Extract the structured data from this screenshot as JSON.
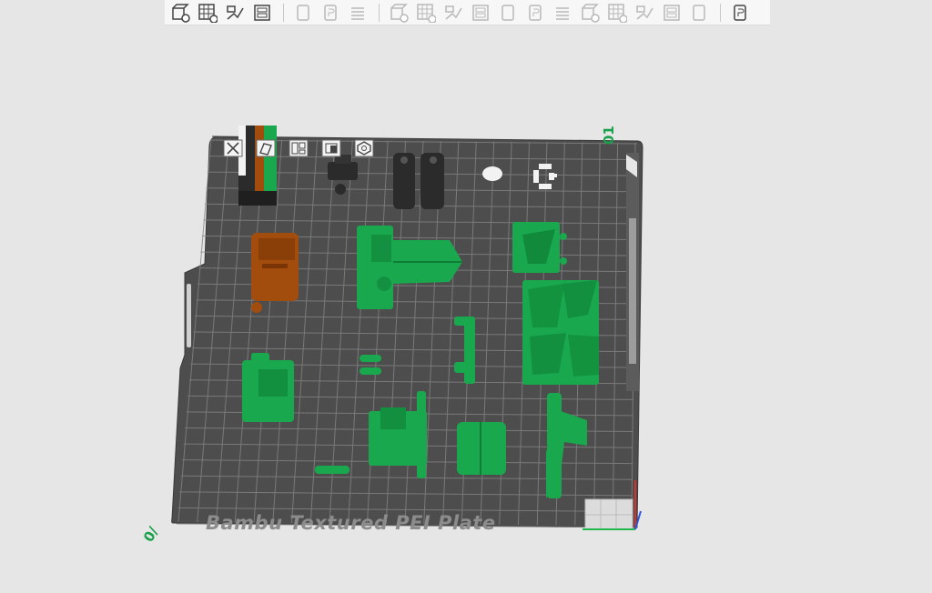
{
  "toolbar": {
    "groups": [
      [
        "add-cube-icon",
        "add-grid-icon",
        "auto-orient-icon",
        "arrange-icon"
      ],
      [
        "copy-plate-icon",
        "plate-p-icon",
        "layer-icon"
      ],
      [
        "move-icon",
        "rotate-icon",
        "scale-icon",
        "lay-flat-icon",
        "cut-icon",
        "split-icon",
        "boolean-icon",
        "support-icon",
        "text-icon",
        "paint-icon",
        "measure-icon",
        "assembly-icon"
      ],
      [
        "view-icon"
      ]
    ]
  },
  "plate": {
    "label": "Bambu Textured PEI Plate",
    "number": "01",
    "number_bottom": "0/",
    "tools": [
      "close-plate-icon",
      "orient-plate-icon",
      "arrange-plate-icon",
      "lock-plate-icon",
      "settings-plate-icon"
    ],
    "colors": {
      "plate": "#4d4d4d",
      "grid": "#8a8a8a",
      "green": "#1aa84f",
      "black": "#2b2b2b",
      "orange": "#a24d0e",
      "white": "#f2f2f2",
      "axis_x": "#d9302b",
      "axis_y": "#1fb84f",
      "axis_z": "#2b55d9"
    }
  }
}
